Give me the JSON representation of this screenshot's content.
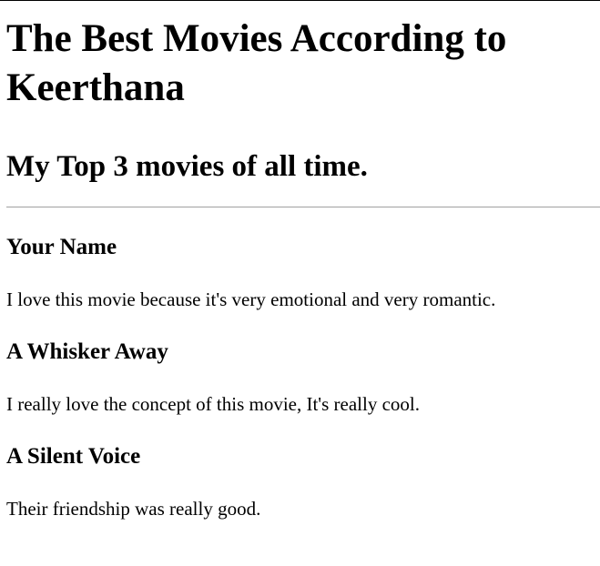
{
  "page": {
    "title": "The Best Movies According to Keerthana",
    "subtitle": "My Top 3 movies of all time."
  },
  "movies": [
    {
      "name": "Your Name",
      "description": "I love this movie because it's very emotional and very romantic."
    },
    {
      "name": "A Whisker Away",
      "description": "I really love the concept of this movie, It's really cool."
    },
    {
      "name": "A Silent Voice",
      "description": "Their friendship was really good."
    }
  ]
}
